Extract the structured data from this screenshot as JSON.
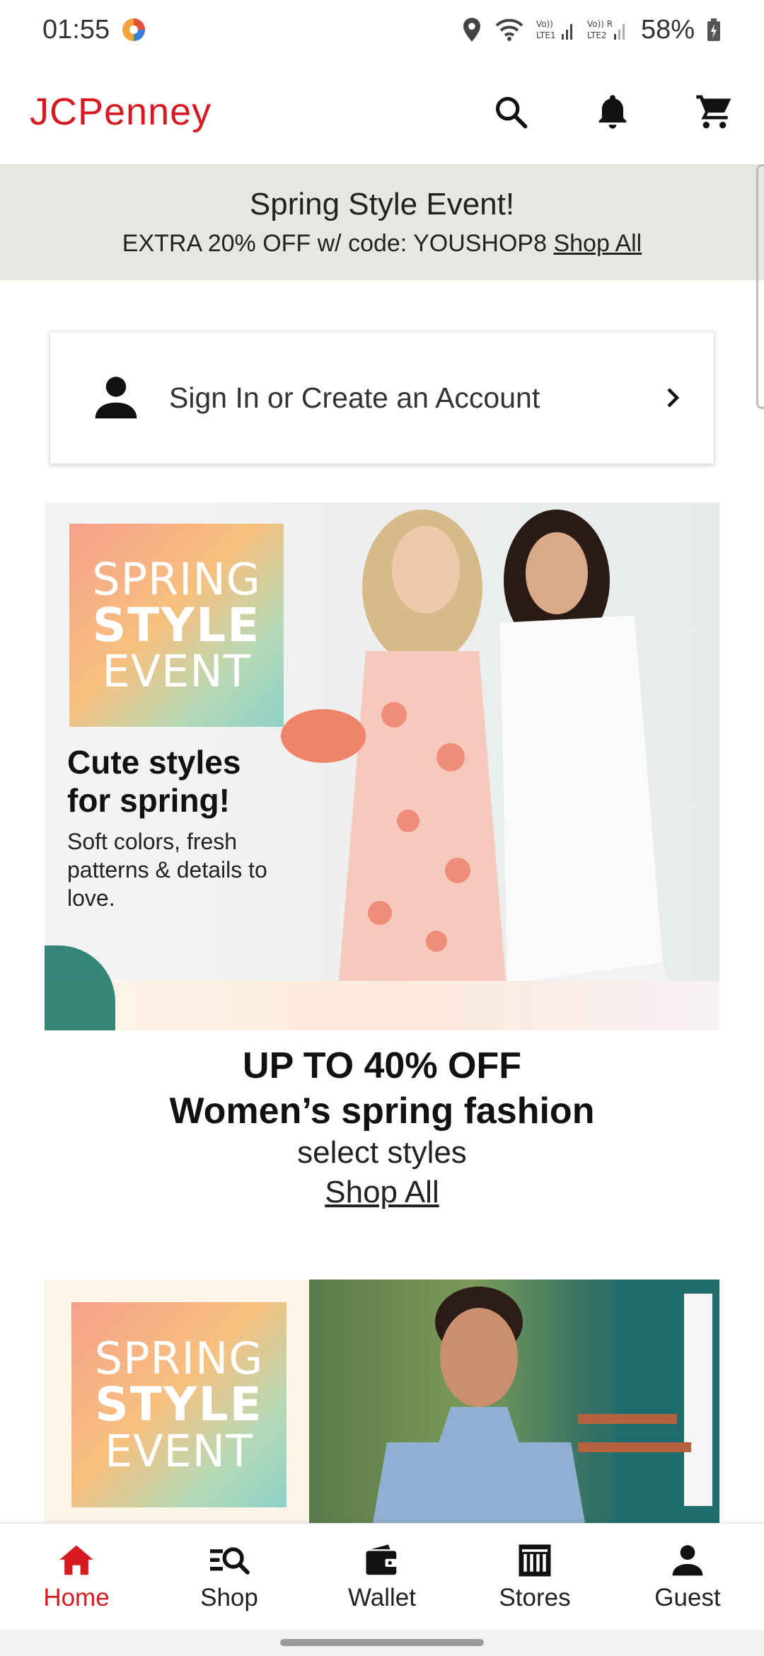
{
  "status_bar": {
    "time": "01:55",
    "battery_percent": "58%",
    "icons": [
      "location-icon",
      "wifi-icon",
      "signal-lte1-icon",
      "signal-lte2-icon",
      "battery-icon"
    ]
  },
  "header": {
    "brand": "JCPenney",
    "brand_color": "#d71921",
    "actions": [
      "search-icon",
      "bell-icon",
      "cart-icon"
    ]
  },
  "promo": {
    "title": "Spring Style Event!",
    "text": "EXTRA 20% OFF w/ code: YOUSHOP8",
    "link": "Shop All",
    "background": "#e8e6e1"
  },
  "signin": {
    "label": "Sign In or Create an Account"
  },
  "hero": {
    "badge_line1": "SPRING",
    "badge_line2": "STYLE",
    "badge_line3": "EVENT",
    "headline": "Cute styles for spring!",
    "body": "Soft colors, fresh patterns & details to love."
  },
  "sale": {
    "line1": "UP TO 40% OFF",
    "line2": "Women’s spring fashion",
    "line3": "select styles",
    "link": "Shop All"
  },
  "banner2": {
    "badge_line1": "SPRING",
    "badge_line2": "STYLE",
    "badge_line3": "EVENT"
  },
  "bottom_nav": {
    "active_color": "#d71921",
    "items": [
      {
        "label": "Home",
        "icon": "home-icon"
      },
      {
        "label": "Shop",
        "icon": "shop-search-icon"
      },
      {
        "label": "Wallet",
        "icon": "wallet-icon"
      },
      {
        "label": "Stores",
        "icon": "store-icon"
      },
      {
        "label": "Guest",
        "icon": "person-icon"
      }
    ]
  }
}
